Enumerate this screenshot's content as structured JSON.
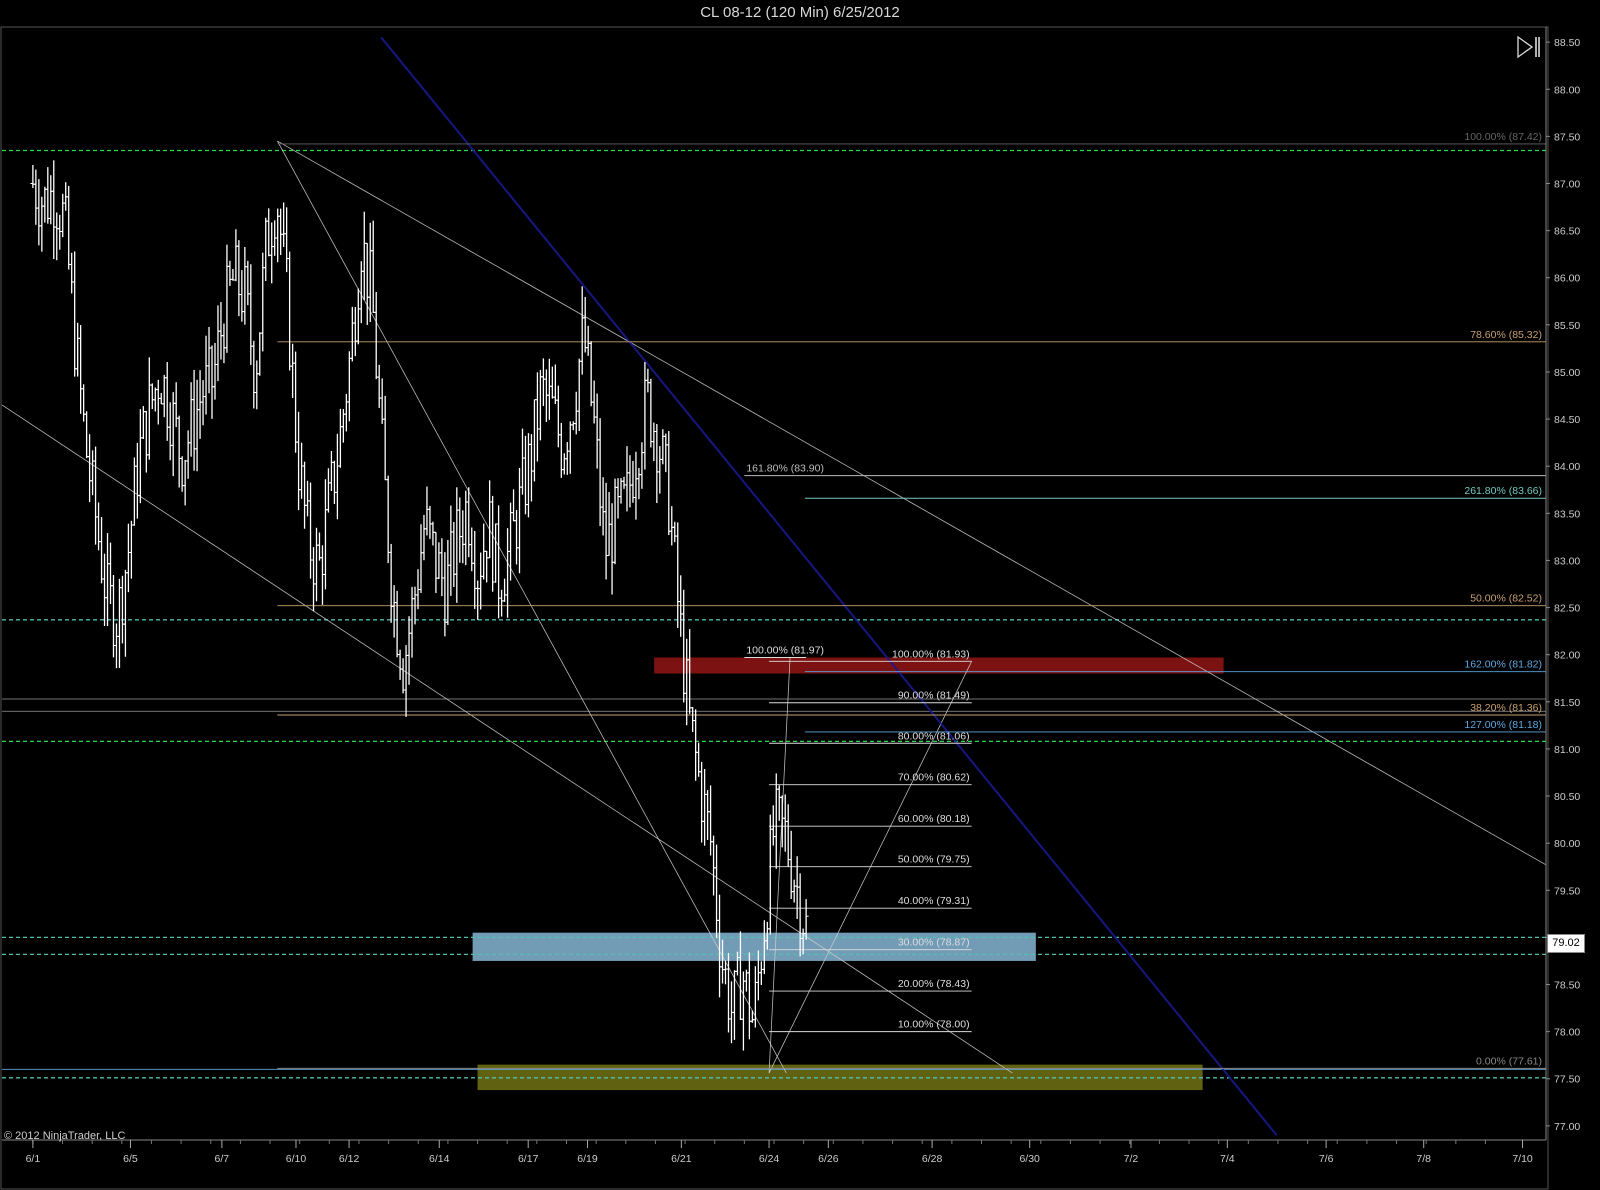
{
  "title": "CL 08-12 (120 Min)  6/25/2012",
  "copyright": "© 2012 NinjaTrader, LLC",
  "last_price": "79.02",
  "colors": {
    "background": "#000000",
    "bar": "#ffffff",
    "fib_orange": "#c8a070",
    "fib_blue": "#5fa8e0",
    "fib_teal": "#70c8c0",
    "support_green": "#22dd44",
    "dashed_cyan": "#50c0b0",
    "trend_blue": "#1a1a90",
    "zone_red": "#8b1414",
    "zone_blue": "#86b6d6",
    "zone_olive": "#6b6b14"
  },
  "icons": {
    "play_end": "skip-to-end-icon"
  },
  "chart_data": {
    "type": "ohlc",
    "title": "CL 08-12 (120 Min)  6/25/2012",
    "ylim": [
      76.85,
      88.65
    ],
    "y_ticks": [
      "77.00",
      "77.50",
      "78.00",
      "78.50",
      "79.00",
      "79.50",
      "80.00",
      "80.50",
      "81.00",
      "81.50",
      "82.00",
      "82.50",
      "83.00",
      "83.50",
      "84.00",
      "84.50",
      "85.00",
      "85.50",
      "86.00",
      "86.50",
      "87.00",
      "87.50",
      "88.00",
      "88.50"
    ],
    "x_ticks": [
      {
        "label": "6/1",
        "x": 0
      },
      {
        "label": "6/5",
        "x": 7.9
      },
      {
        "label": "6/7",
        "x": 15.3
      },
      {
        "label": "6/10",
        "x": 21.3
      },
      {
        "label": "6/12",
        "x": 25.6
      },
      {
        "label": "6/14",
        "x": 32.9
      },
      {
        "label": "6/17",
        "x": 40.1
      },
      {
        "label": "6/19",
        "x": 44.9
      },
      {
        "label": "6/21",
        "x": 52.5
      },
      {
        "label": "6/24",
        "x": 59.6
      },
      {
        "label": "6/26",
        "x": 64.4
      },
      {
        "label": "6/28",
        "x": 72.8
      },
      {
        "label": "6/30",
        "x": 80.7
      },
      {
        "label": "7/2",
        "x": 88.9
      },
      {
        "label": "7/4",
        "x": 96.7
      },
      {
        "label": "7/6",
        "x": 104.7
      },
      {
        "label": "7/8",
        "x": 112.6
      },
      {
        "label": "7/10",
        "x": 120.6
      }
    ],
    "xlim": [
      -2.5,
      122.5
    ],
    "price_path": [
      87.0,
      86.8,
      86.9,
      86.6,
      85.3,
      84.2,
      83.4,
      82.6,
      82.4,
      83.1,
      84.1,
      84.6,
      85.0,
      84.6,
      84.1,
      84.4,
      84.8,
      84.9,
      85.6,
      86.0,
      85.8,
      85.0,
      86.3,
      86.9,
      85.8,
      84.1,
      83.2,
      82.9,
      83.6,
      84.3,
      85.2,
      86.4,
      85.8,
      84.1,
      82.6,
      81.9,
      82.6,
      83.4,
      83.0,
      82.7,
      83.2,
      83.6,
      82.9,
      83.4,
      82.8,
      83.1,
      83.6,
      84.1,
      84.8,
      84.6,
      84.2,
      84.7,
      85.4,
      84.4,
      83.1,
      83.4,
      83.6,
      84.2,
      84.7,
      84.3,
      83.7,
      82.4,
      81.3,
      80.6,
      80.0,
      78.8,
      78.2,
      78.6,
      78.1,
      79.1,
      80.2,
      80.1,
      79.6,
      79.1
    ],
    "fib_levels": [
      {
        "label": "100.00% (87.42)",
        "price": 87.42,
        "color": "#666666"
      },
      {
        "label": "78.60% (85.32)",
        "price": 85.32,
        "color": "#c8a070"
      },
      {
        "label": "261.80% (83.66)",
        "price": 83.66,
        "color": "#70c8c0"
      },
      {
        "label": "161.80% (83.90)",
        "price": 83.9,
        "color": "#bbbbbb"
      },
      {
        "label": "50.00% (82.52)",
        "price": 82.52,
        "color": "#c8a070"
      },
      {
        "label": "100.00% (81.97)",
        "price": 81.97,
        "color": "#dddddd"
      },
      {
        "label": "100.00% (81.93)",
        "price": 81.93,
        "color": "#dddddd"
      },
      {
        "label": "162.00% (81.82)",
        "price": 81.82,
        "color": "#5fa8e0"
      },
      {
        "label": "90.00% (81.49)",
        "price": 81.49,
        "color": "#dddddd"
      },
      {
        "label": "38.20% (81.36)",
        "price": 81.36,
        "color": "#c8a070"
      },
      {
        "label": "127.00% (81.18)",
        "price": 81.18,
        "color": "#5fa8e0"
      },
      {
        "label": "80.00% (81.06)",
        "price": 81.06,
        "color": "#dddddd"
      },
      {
        "label": "70.00% (80.62)",
        "price": 80.62,
        "color": "#dddddd"
      },
      {
        "label": "60.00% (80.18)",
        "price": 80.18,
        "color": "#dddddd"
      },
      {
        "label": "50.00% (79.75)",
        "price": 79.75,
        "color": "#dddddd"
      },
      {
        "label": "40.00% (79.31)",
        "price": 79.31,
        "color": "#dddddd"
      },
      {
        "label": "30.00% (78.87)",
        "price": 78.87,
        "color": "#dddddd"
      },
      {
        "label": "20.00% (78.43)",
        "price": 78.43,
        "color": "#dddddd"
      },
      {
        "label": "10.00% (78.00)",
        "price": 78.0,
        "color": "#dddddd"
      },
      {
        "label": "0.00% (77.61)",
        "price": 77.61,
        "color": "#888888"
      }
    ],
    "horizontal_lines": [
      {
        "price": 87.35,
        "style": "dashed",
        "color": "#22dd44"
      },
      {
        "price": 82.37,
        "style": "dashed",
        "color": "#50c0b0"
      },
      {
        "price": 81.53,
        "style": "solid",
        "color": "#999999"
      },
      {
        "price": 81.4,
        "style": "solid",
        "color": "#999999"
      },
      {
        "price": 81.08,
        "style": "dashed",
        "color": "#22dd44"
      },
      {
        "price": 79.0,
        "style": "dashed",
        "color": "#50c0b0"
      },
      {
        "price": 78.82,
        "style": "dashed",
        "color": "#50c0b0"
      },
      {
        "price": 77.6,
        "style": "solid",
        "color": "#5fa8e0"
      },
      {
        "price": 77.51,
        "style": "dashed",
        "color": "#50c0b0"
      }
    ],
    "zones": [
      {
        "name": "resistance-zone",
        "price_top": 81.97,
        "price_bottom": 81.8,
        "x_start": 50.3,
        "x_end": 96.4,
        "color": "#8b1414"
      },
      {
        "name": "support-zone",
        "price_top": 79.05,
        "price_bottom": 78.75,
        "x_start": 35.6,
        "x_end": 81.2,
        "color": "#86b6d6"
      },
      {
        "name": "demand-zone",
        "price_top": 77.65,
        "price_bottom": 77.38,
        "x_start": 36.0,
        "x_end": 94.7,
        "color": "#6b6b14"
      }
    ],
    "trendlines": [
      {
        "x1": 19.8,
        "y1": 87.45,
        "x2": 122.5,
        "y2": 79.77,
        "color": "#cccccc",
        "width": 0.8
      },
      {
        "x1": -2.5,
        "y1": 84.65,
        "x2": 79.3,
        "y2": 77.56,
        "color": "#cccccc",
        "width": 0.8
      },
      {
        "x1": 19.8,
        "y1": 87.45,
        "x2": 61.0,
        "y2": 77.56,
        "color": "#cccccc",
        "width": 0.8
      },
      {
        "x1": 59.6,
        "y1": 77.56,
        "x2": 61.3,
        "y2": 81.97,
        "color": "#cccccc",
        "width": 0.8
      },
      {
        "x1": 59.6,
        "y1": 77.56,
        "x2": 76.0,
        "y2": 81.93,
        "color": "#cccccc",
        "width": 0.8
      },
      {
        "x1": 28.2,
        "y1": 88.55,
        "x2": 100.7,
        "y2": 76.9,
        "color": "#1a1a90",
        "width": 2.0
      }
    ]
  }
}
